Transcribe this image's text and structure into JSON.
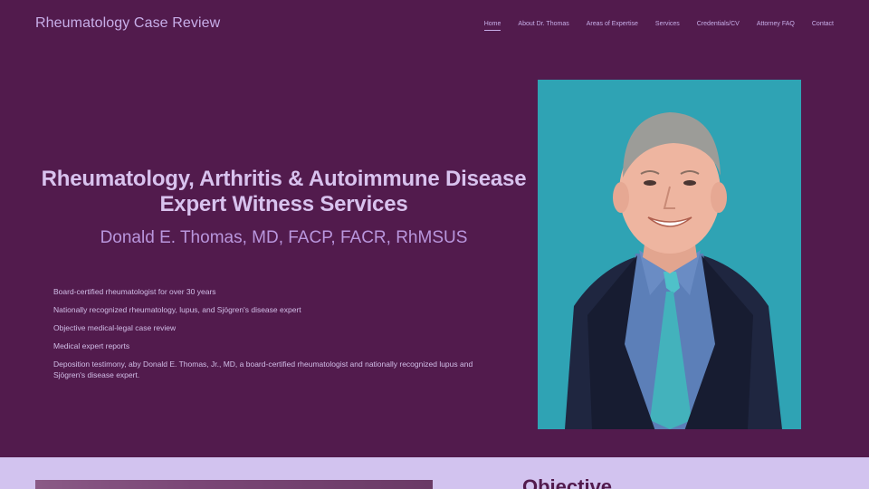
{
  "site": {
    "title": "Rheumatology Case Review"
  },
  "nav": {
    "items": [
      {
        "label": "Home",
        "active": true
      },
      {
        "label": "About Dr. Thomas",
        "active": false
      },
      {
        "label": "Areas of Expertise",
        "active": false
      },
      {
        "label": "Services",
        "active": false
      },
      {
        "label": "Credentials/CV",
        "active": false
      },
      {
        "label": "Attorney FAQ",
        "active": false
      },
      {
        "label": "Contact",
        "active": false
      }
    ]
  },
  "hero": {
    "heading_line1": "Rheumatology, Arthritis & Autoimmune Disease",
    "heading_line2": "Expert Witness Services",
    "subheading": "Donald E. Thomas, MD, FACP, FACR, RhMSUS",
    "bullets": [
      "Board-certified rheumatologist for over 30 years",
      "Nationally recognized rheumatology, lupus, and Sjögren's disease expert",
      "Objective medical-legal case review",
      "Medical expert reports",
      "Deposition testimony, aby Donald E. Thomas, Jr., MD, a board-certified rheumatologist and nationally recognized lupus and Sjögren's disease expert."
    ]
  },
  "lower": {
    "heading": "Objective"
  },
  "colors": {
    "background": "#521b4d",
    "accent_text": "#c7aee8",
    "lower_background": "#d2c3ef",
    "portrait_background": "#2fa3b4"
  }
}
